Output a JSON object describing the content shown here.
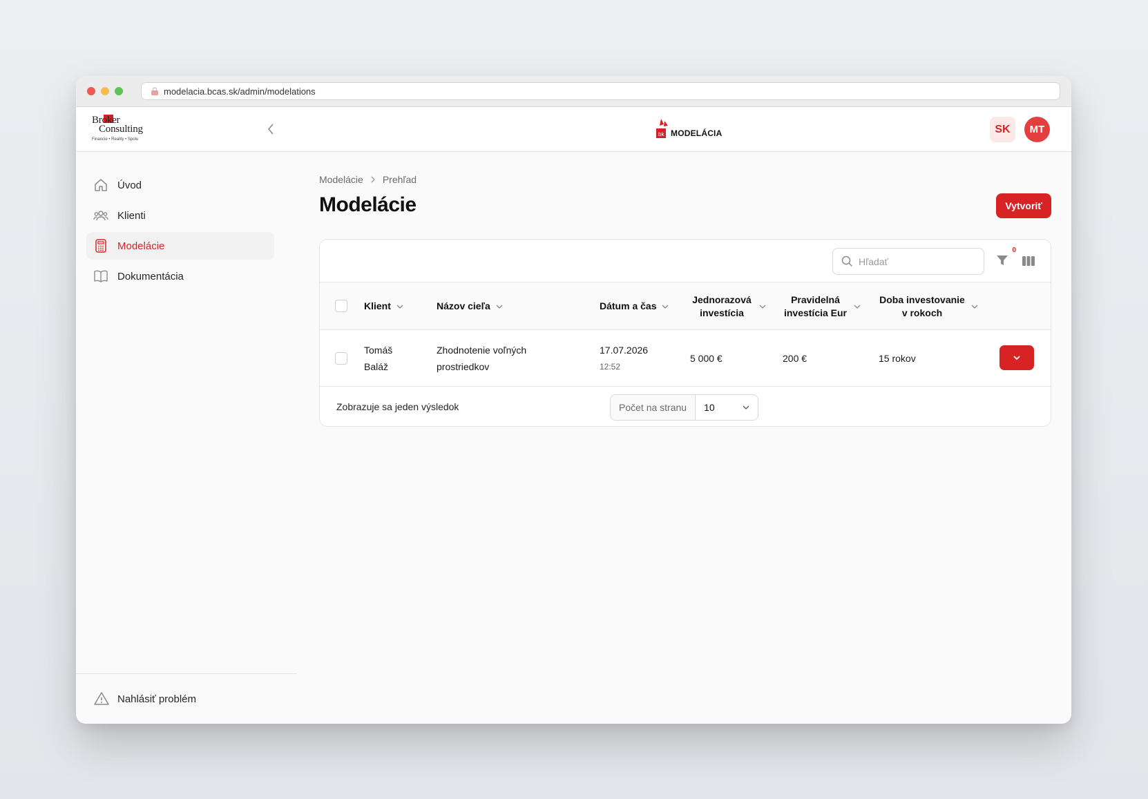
{
  "browser": {
    "url": "modelacia.bcas.sk/admin/modelations",
    "dots": [
      "#ee5a52",
      "#f5bd4f",
      "#5fc454"
    ]
  },
  "header": {
    "brand_line1": "Broker",
    "brand_line2": "Consulting",
    "brand_sub": "Financie • Reality • Spolu",
    "app_logo_text": "MODELÁCIA",
    "lang": "SK",
    "avatar_initials": "MT"
  },
  "sidebar": {
    "items": [
      {
        "label": "Úvod",
        "icon": "home-icon"
      },
      {
        "label": "Klienti",
        "icon": "users-icon"
      },
      {
        "label": "Modelácie",
        "icon": "calculator-icon",
        "active": true
      },
      {
        "label": "Dokumentácia",
        "icon": "book-icon"
      }
    ],
    "report_problem": "Nahlásiť problém"
  },
  "breadcrumb": {
    "parent": "Modelácie",
    "current": "Prehľad"
  },
  "page": {
    "title": "Modelácie",
    "create_label": "Vytvoriť"
  },
  "table": {
    "search_placeholder": "Hľadať",
    "filter_count": "0",
    "columns": [
      {
        "label": "Klient"
      },
      {
        "label": "Názov cieľa"
      },
      {
        "label": "Dátum a čas"
      },
      {
        "label": "Jednorazová investícia"
      },
      {
        "label": "Pravidelná investícia Eur"
      },
      {
        "label": "Doba investovanie v rokoch"
      }
    ],
    "rows": [
      {
        "client_line1": "Tomáš",
        "client_line2": "Baláž",
        "goal_line1": "Zhodnotenie voľných",
        "goal_line2": "prostriedkov",
        "date": "17.07.2026",
        "time": "12:52",
        "one_time": "5 000 €",
        "regular": "200 €",
        "duration": "15 rokov"
      }
    ],
    "result_text": "Zobrazuje sa jeden výsledok",
    "per_page_label": "Počet na stranu",
    "per_page_value": "10"
  },
  "colors": {
    "accent": "#d72323",
    "active_nav": "#d32424"
  }
}
